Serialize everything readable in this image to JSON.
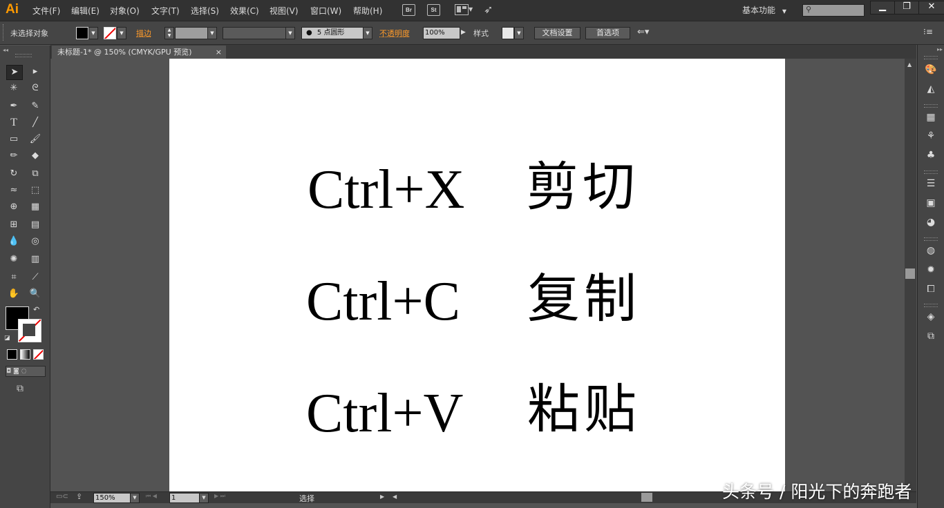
{
  "app": {
    "logo": "Ai"
  },
  "menu": [
    "文件(F)",
    "编辑(E)",
    "对象(O)",
    "文字(T)",
    "选择(S)",
    "效果(C)",
    "视图(V)",
    "窗口(W)",
    "帮助(H)"
  ],
  "menubar_icons": {
    "bridge": "Br",
    "stock": "St"
  },
  "workspace": "基本功能",
  "window_controls": {
    "minimize": "▁",
    "restore": "❐",
    "close": "✕"
  },
  "control_bar": {
    "selection_status": "未选择对象",
    "stroke_label": "描边",
    "brush_label": "5 点圆形",
    "opacity_label": "不透明度",
    "opacity_value": "100%",
    "style_label": "样式",
    "doc_setup": "文档设置",
    "preferences": "首选项"
  },
  "document_tab": {
    "title": "未标题-1* @ 150% (CMYK/GPU 预览)",
    "close": "×"
  },
  "artboard": {
    "rows": [
      {
        "shortcut": "Ctrl+X",
        "action": "剪切"
      },
      {
        "shortcut": "Ctrl+C",
        "action": "复制"
      },
      {
        "shortcut": "Ctrl+V",
        "action": "粘贴"
      }
    ]
  },
  "status_bar": {
    "zoom": "150%",
    "page": "1",
    "tool_status": "选择"
  },
  "watermark": "头条号 / 阳光下的奔跑者",
  "colors": {
    "accent": "#ff9a00",
    "chrome_dark": "#323232",
    "panel": "#454545",
    "pasteboard": "#535353",
    "artboard": "#ffffff"
  }
}
